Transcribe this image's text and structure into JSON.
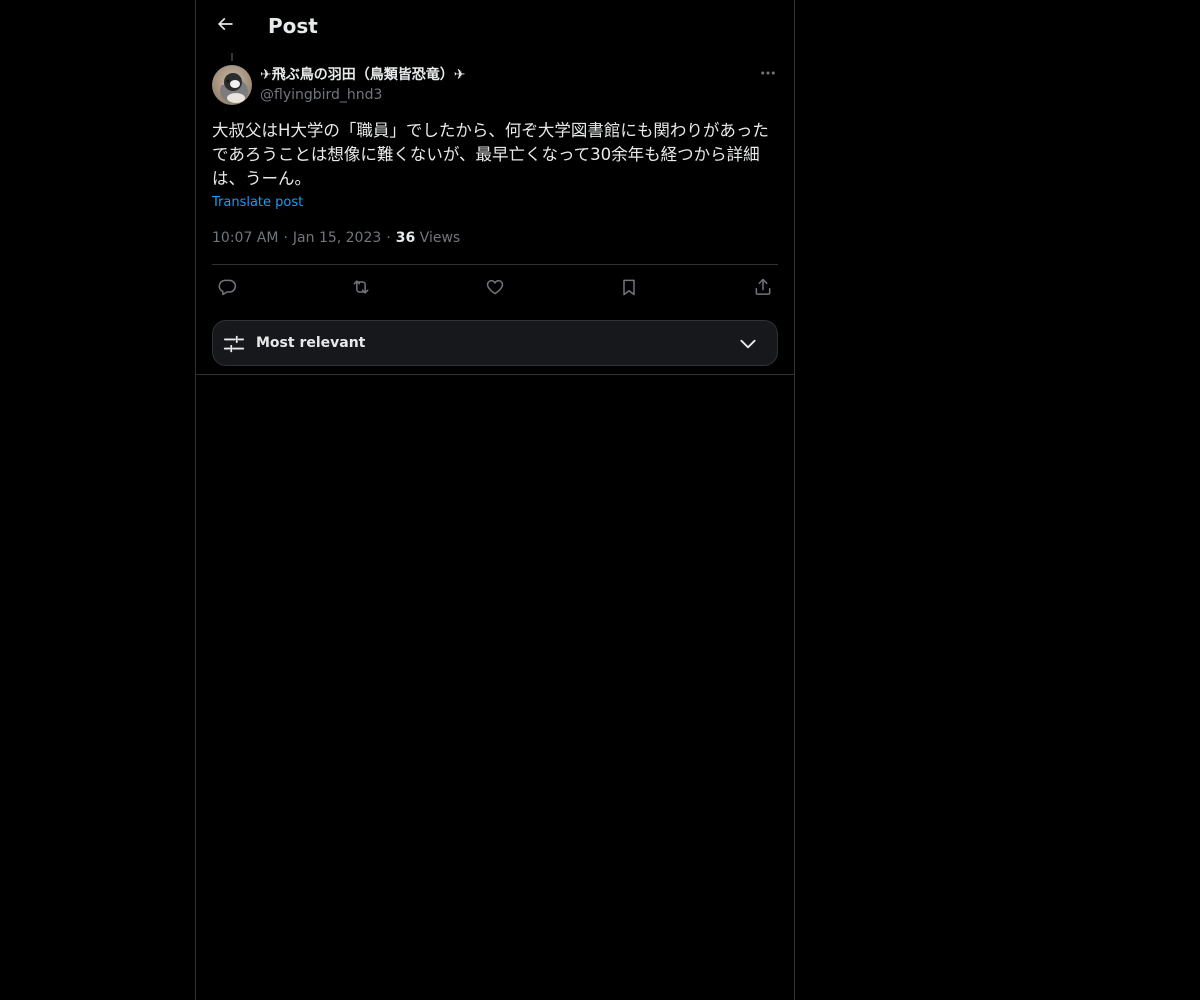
{
  "header": {
    "title": "Post",
    "back_icon": "arrow-left-icon"
  },
  "post": {
    "author": {
      "display_name": "✈飛ぶ鳥の羽田（鳥類皆恐竜）✈",
      "handle": "@flyingbird_hnd3",
      "avatar_icon": "bird-avatar"
    },
    "text": "大叔父はH大学の「職員」でしたから、何ぞ大学図書館にも関わりがあったであろうことは想像に難くないが、最早亡くなって30余年も経つから詳細は、うーん。",
    "translate_label": "Translate post",
    "time": "10:07 AM",
    "date": "Jan 15, 2023",
    "views_count": "36",
    "views_label": "Views",
    "dot": "·"
  },
  "actions": {
    "reply_icon": "reply-icon",
    "repost_icon": "repost-icon",
    "like_icon": "heart-icon",
    "bookmark_icon": "bookmark-icon",
    "share_icon": "share-icon"
  },
  "sort": {
    "label": "Most relevant",
    "icon": "sliders-icon"
  },
  "colors": {
    "background": "#000000",
    "text": "#e7e9ea",
    "muted": "#71767b",
    "link": "#1d9bf0",
    "border": "#2f3336"
  }
}
